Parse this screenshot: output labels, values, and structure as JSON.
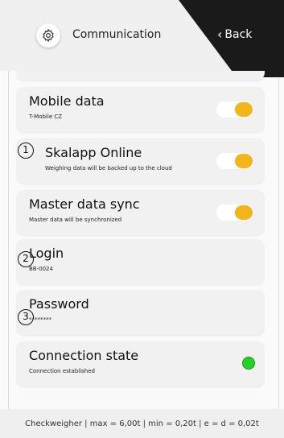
{
  "header": {
    "title": "Communication",
    "back_label": "Back",
    "back_chevron": "‹"
  },
  "settings": [
    {
      "title": "Mobile data",
      "subtitle": "T-Mobile CZ",
      "control": "toggle",
      "state": "on"
    },
    {
      "title": "Skalapp Online",
      "subtitle": "Weighing data will be backed up to the cloud",
      "control": "toggle",
      "state": "on"
    },
    {
      "title": "Master data sync",
      "subtitle": "Master data will be synchronized",
      "control": "toggle",
      "state": "on"
    },
    {
      "title": "Login",
      "subtitle": "BB-0024",
      "control": "none"
    },
    {
      "title": "Password",
      "subtitle": "********",
      "control": "none"
    },
    {
      "title": "Connection state",
      "subtitle": "Connection established",
      "control": "status",
      "state": "connected"
    }
  ],
  "markers": [
    "1",
    "2",
    "3"
  ],
  "footer": {
    "text": "Checkweigher | max = 6,00t | min = 0,20t | e = d = 0,02t"
  },
  "colors": {
    "toggle_on": "#f2b51a",
    "status_ok": "#23d323",
    "back_background": "#1a1a1a"
  },
  "icons": {
    "settings": "gear-icon",
    "back": "chevron-left-icon"
  }
}
